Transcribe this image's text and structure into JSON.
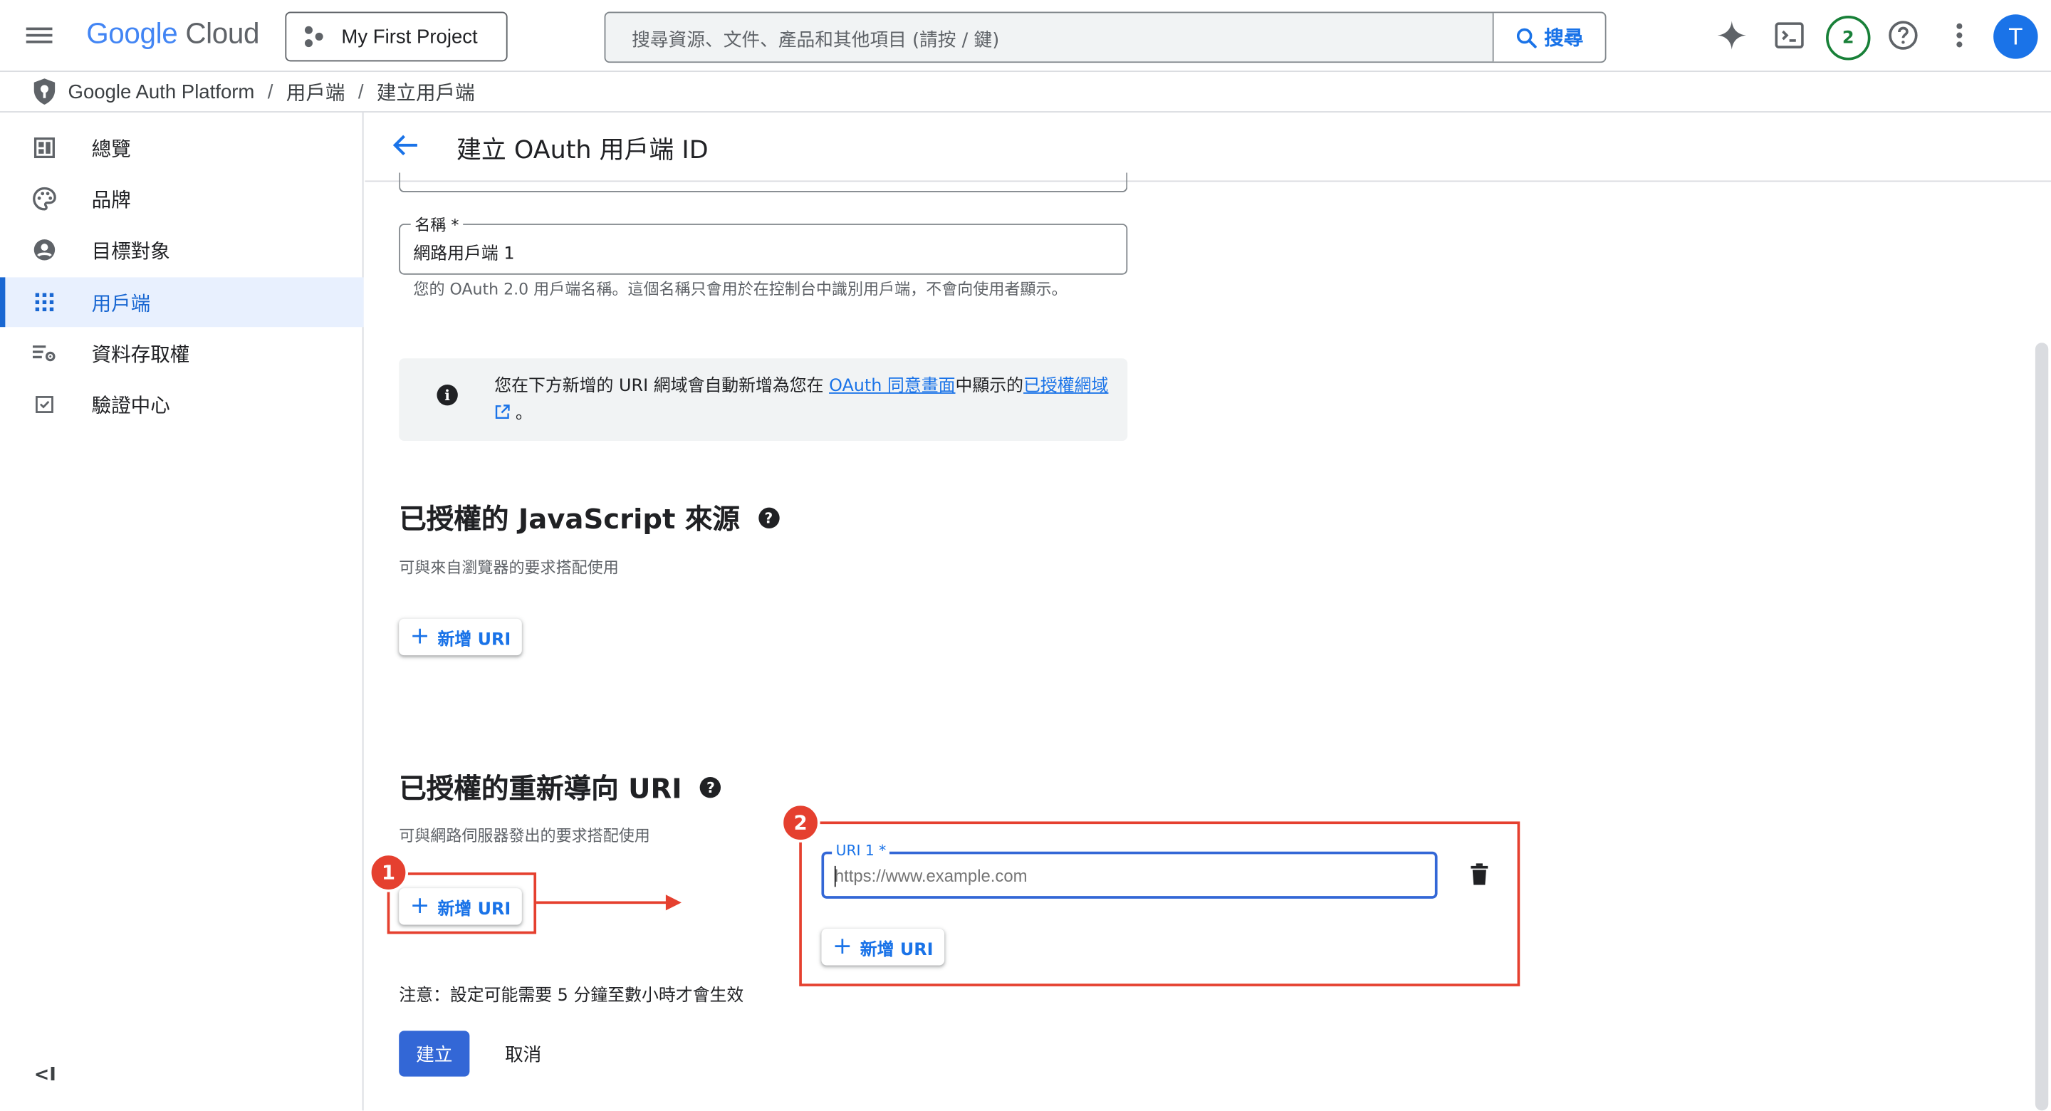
{
  "header": {
    "logo_google": "Google",
    "logo_cloud": "Cloud",
    "project": "My First Project",
    "search_placeholder": "搜尋資源、文件、產品和其他項目 (請按 / 鍵)",
    "search_button": "搜尋",
    "notifications_count": "2",
    "avatar_letter": "T",
    "icons": [
      "menu-icon",
      "gemini-spark-icon",
      "cloud-shell-icon",
      "help-icon",
      "more-vert-icon"
    ]
  },
  "breadcrumb": {
    "items": [
      "Google Auth Platform",
      "用戶端",
      "建立用戶端"
    ],
    "separator": "/"
  },
  "sidebar": {
    "items": [
      {
        "label": "總覽",
        "icon": "dashboard-icon"
      },
      {
        "label": "品牌",
        "icon": "palette-icon"
      },
      {
        "label": "目標對象",
        "icon": "account-circle-icon"
      },
      {
        "label": "用戶端",
        "icon": "apps-grid-icon",
        "active": true
      },
      {
        "label": "資料存取權",
        "icon": "data-access-icon"
      },
      {
        "label": "驗證中心",
        "icon": "verification-check-icon"
      }
    ],
    "collapse_label": "<I"
  },
  "page": {
    "title": "建立 OAuth 用戶端 ID"
  },
  "form": {
    "name_label": "名稱 *",
    "name_value": "網路用戶端 1",
    "name_helper": "您的 OAuth 2.0 用戶端名稱。這個名稱只會用於在控制台中識別用戶端，不會向使用者顯示。",
    "info": {
      "before": "您在下方新增的 URI 網域會自動新增為您在 ",
      "link1": "OAuth 同意畫面",
      "middle": "中顯示的",
      "link2": "已授權網域",
      "after": " 。"
    },
    "js_origins": {
      "title": "已授權的 JavaScript 來源",
      "subtitle": "可與來自瀏覽器的要求搭配使用",
      "add_button": "新增 URI"
    },
    "redirect_uris": {
      "title": "已授權的重新導向 URI",
      "subtitle": "可與網路伺服器發出的要求搭配使用",
      "add_button": "新增 URI",
      "uri_label": "URI 1 *",
      "uri_placeholder": "https://www.example.com",
      "add_button_2": "新增 URI"
    },
    "note": "注意：設定可能需要 5 分鐘至數小時才會生效",
    "create_button": "建立",
    "cancel_button": "取消"
  },
  "annotations": {
    "step1": "1",
    "step2": "2",
    "color": "#e5402f"
  },
  "colors": {
    "accent": "#1a73e8",
    "primary_button": "#3367d6",
    "active_nav_bg": "#e8f0fe"
  }
}
